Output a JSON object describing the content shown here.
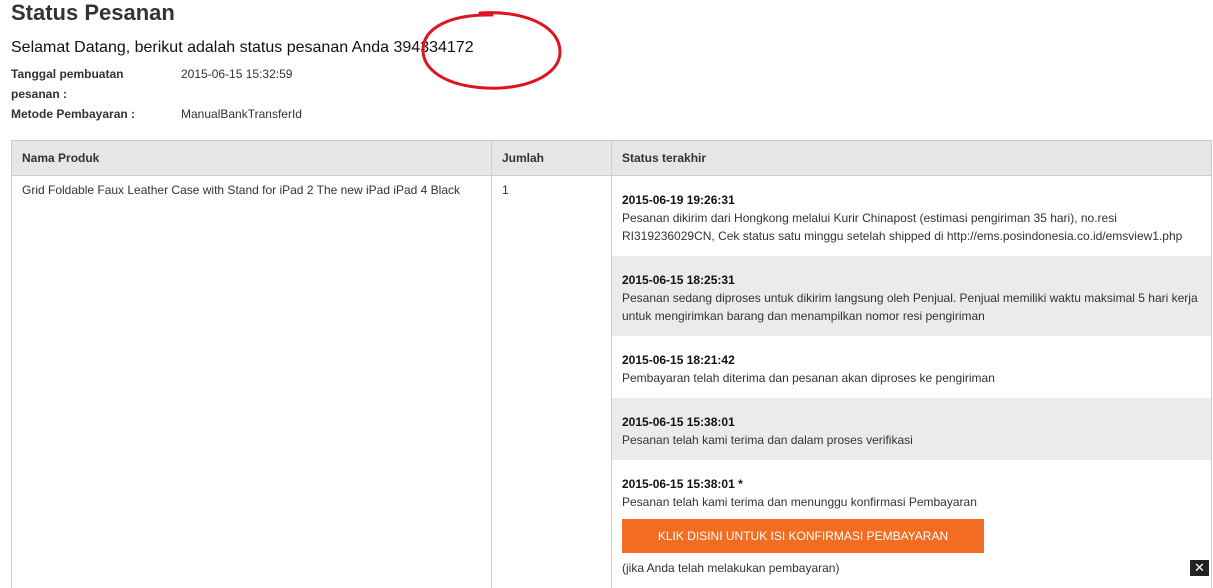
{
  "page": {
    "title": "Status Pesanan",
    "welcome_text": "Selamat Datang, berikut adalah status pesanan Anda",
    "order_number": "394334172"
  },
  "meta": {
    "created_label_1": "Tanggal pembuatan",
    "created_label_2": "pesanan :",
    "created_value": "2015-06-15 15:32:59",
    "payment_label": "Metode Pembayaran :",
    "payment_value": "ManualBankTransferId"
  },
  "table": {
    "headers": [
      "Nama Produk",
      "Jumlah",
      "Status terakhir"
    ],
    "product_name": "Grid Foldable Faux Leather Case with Stand for iPad 2 The new iPad iPad 4 Black",
    "quantity": "1",
    "statuses": [
      {
        "time": "2015-06-19 19:26:31",
        "desc": "Pesanan dikirim dari Hongkong melalui Kurir Chinapost (estimasi pengiriman 35 hari), no.resi RI319236029CN, Cek status satu minggu setelah shipped di http://ems.posindonesia.co.id/emsview1.php"
      },
      {
        "time": "2015-06-15 18:25:31",
        "desc": "Pesanan sedang diproses untuk dikirim langsung oleh Penjual. Penjual memiliki waktu maksimal 5 hari kerja untuk mengirimkan barang dan menampilkan nomor resi pengiriman"
      },
      {
        "time": "2015-06-15 18:21:42",
        "desc": "Pembayaran telah diterima dan pesanan akan diproses ke pengiriman"
      },
      {
        "time": "2015-06-15 15:38:01",
        "desc": "Pesanan telah kami terima dan dalam proses verifikasi"
      },
      {
        "time": "2015-06-15 15:38:01 *",
        "desc": "Pesanan telah kami terima dan menunggu konfirmasi Pembayaran",
        "button_label": "KLIK DISINI UNTUK ISI KONFIRMASI PEMBAYARAN",
        "note": "(jika Anda telah melakukan pembayaran)"
      }
    ]
  },
  "close_label": "✕",
  "colors": {
    "accent": "#f26c22",
    "annotation_circle": "#e0141e",
    "header_bg": "#e6e6e6",
    "row_alt_bg": "#ebebeb"
  }
}
